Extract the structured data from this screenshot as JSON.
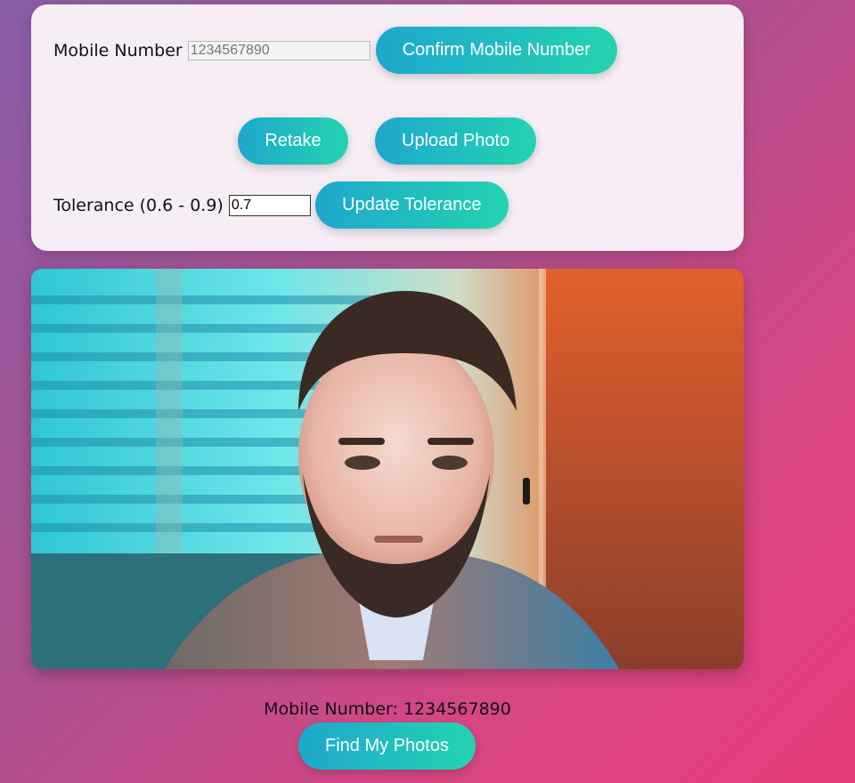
{
  "form": {
    "mobile_label": "Mobile Number",
    "mobile_value": "1234567890",
    "confirm_label": "Confirm Mobile Number",
    "retake_label": "Retake",
    "upload_label": "Upload Photo",
    "tolerance_label": "Tolerance (0.6 - 0.9)",
    "tolerance_value": "0.7",
    "update_label": "Update Tolerance"
  },
  "result": {
    "mobile_display": "Mobile Number: 1234567890",
    "find_label": "Find My Photos"
  },
  "colors": {
    "button_gradient_start": "#1ea7cd",
    "button_gradient_end": "#24d3b0",
    "panel_bg": "#f6eef4"
  },
  "icons": {
    "photo": "webcam-photo"
  }
}
